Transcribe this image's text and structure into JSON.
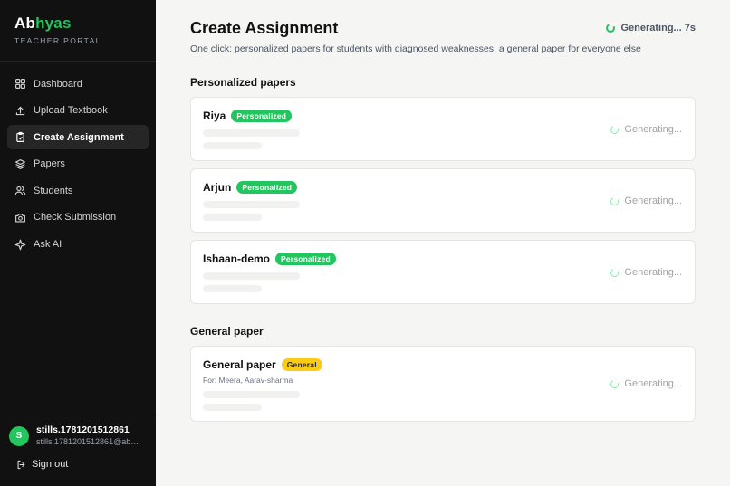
{
  "brand": {
    "logo_part1": "Ab",
    "logo_part2": "hyas",
    "subtitle": "TEACHER PORTAL"
  },
  "nav": [
    {
      "label": "Dashboard",
      "icon": "grid-icon",
      "active": false
    },
    {
      "label": "Upload Textbook",
      "icon": "upload-icon",
      "active": false
    },
    {
      "label": "Create Assignment",
      "icon": "clipboard-icon",
      "active": true
    },
    {
      "label": "Papers",
      "icon": "layers-icon",
      "active": false
    },
    {
      "label": "Students",
      "icon": "users-icon",
      "active": false
    },
    {
      "label": "Check Submission",
      "icon": "camera-icon",
      "active": false
    },
    {
      "label": "Ask AI",
      "icon": "sparkle-icon",
      "active": false
    }
  ],
  "user": {
    "initial": "S",
    "name": "stills.1781201512861",
    "email": "stills.1781201512861@abhya..."
  },
  "signout_label": "Sign out",
  "header": {
    "title": "Create Assignment",
    "subtitle": "One click: personalized papers for students with diagnosed weaknesses, a general paper for everyone else",
    "status": "Generating... 7s"
  },
  "sections": {
    "personalized_title": "Personalized papers",
    "general_title": "General paper"
  },
  "personalized": [
    {
      "name": "Riya",
      "badge": "Personalized",
      "status": "Generating..."
    },
    {
      "name": "Arjun",
      "badge": "Personalized",
      "status": "Generating..."
    },
    {
      "name": "Ishaan-demo",
      "badge": "Personalized",
      "status": "Generating..."
    }
  ],
  "general": {
    "name": "General paper",
    "badge": "General",
    "for_text": "For: Meera, Aarav-sharma",
    "status": "Generating..."
  },
  "colors": {
    "accent": "#22c55e",
    "badge_yellow": "#facc15",
    "sidebar_bg": "#111111"
  }
}
